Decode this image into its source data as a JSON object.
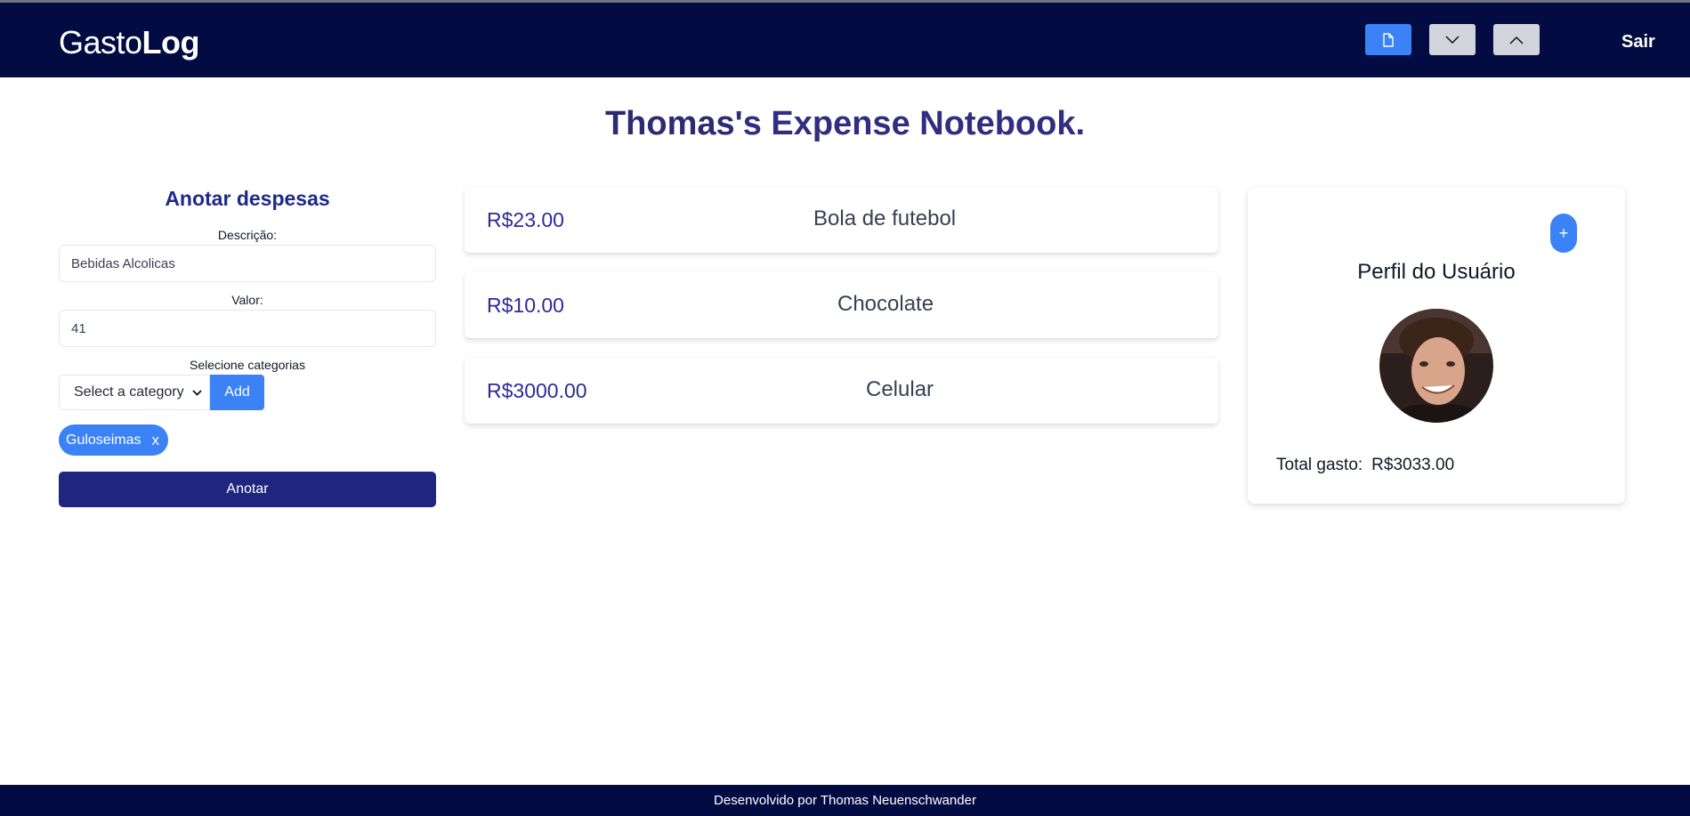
{
  "header": {
    "logo_part1": "Gasto",
    "logo_part2": "Log",
    "logout_label": "Sair",
    "icons": [
      "document-icon",
      "chevron-down-icon",
      "chevron-up-icon"
    ]
  },
  "page_title": {
    "owner": "Thomas",
    "suffix": "'s Expense Notebook."
  },
  "form": {
    "heading": "Anotar despesas",
    "description_label": "Descrição:",
    "description_value": "Bebidas Alcolicas",
    "value_label": "Valor:",
    "value_value": "41",
    "category_label": "Selecione categorias",
    "category_selected": "Select a category",
    "add_label": "Add",
    "tags": [
      "Guloseimas"
    ],
    "tag_remove": "x",
    "submit_label": "Anotar"
  },
  "expenses": [
    {
      "amount": "R$23.00",
      "name": "Bola de futebol"
    },
    {
      "amount": "R$10.00",
      "name": "Chocolate"
    },
    {
      "amount": "R$3000.00",
      "name": "Celular"
    }
  ],
  "profile": {
    "add_symbol": "+",
    "title": "Perfil do Usuário",
    "total_label": "Total gasto:",
    "total_value": "R$3033.00"
  },
  "footer": {
    "text": "Desenvolvido por Thomas Neuenschwander"
  },
  "colors": {
    "navbar": "#020c42",
    "accent": "#3b82f6",
    "submit": "#1e2680",
    "title": "#312e81"
  }
}
